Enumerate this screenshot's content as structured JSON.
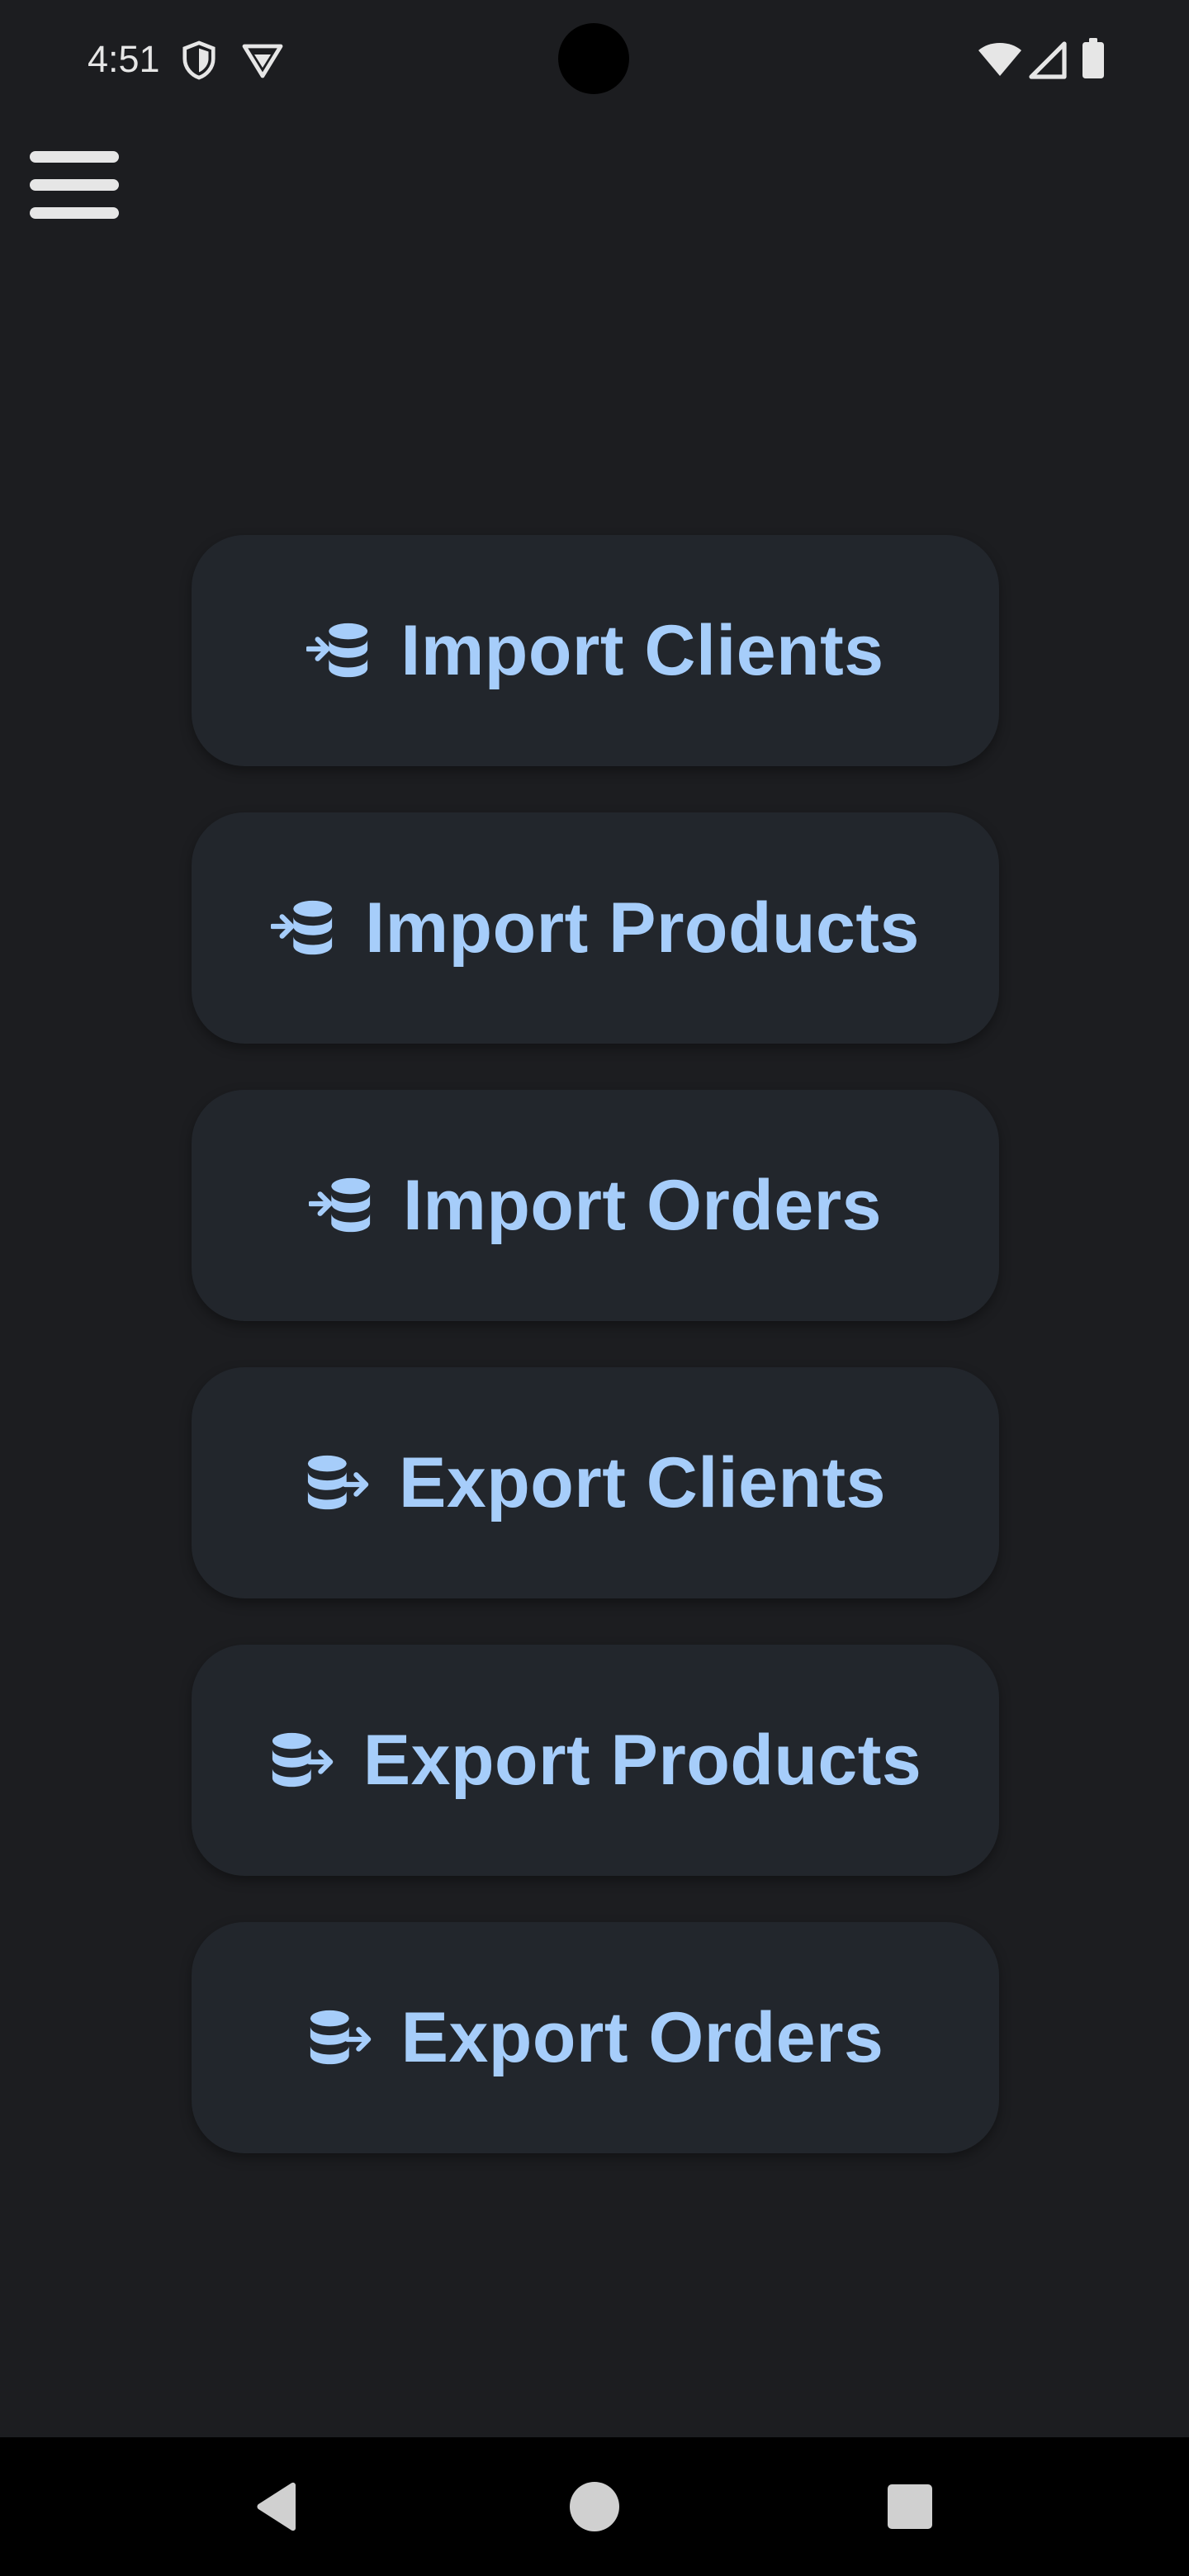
{
  "status_bar": {
    "time": "4:51",
    "icons": [
      "shield-icon",
      "vpn-icon",
      "wifi-icon",
      "cell-signal-icon",
      "battery-icon"
    ]
  },
  "toolbar": {
    "menu_icon": "hamburger-menu-icon"
  },
  "buttons": [
    {
      "label": "Import Clients",
      "icon": "database-import-icon"
    },
    {
      "label": "Import Products",
      "icon": "database-import-icon"
    },
    {
      "label": "Import Orders",
      "icon": "database-import-icon"
    },
    {
      "label": "Export Clients",
      "icon": "database-export-icon"
    },
    {
      "label": "Export Products",
      "icon": "database-export-icon"
    },
    {
      "label": "Export Orders",
      "icon": "database-export-icon"
    }
  ],
  "nav_bar": {
    "icons": [
      "back-icon",
      "home-icon",
      "recents-icon"
    ]
  },
  "colors": {
    "background": "#1c1d20",
    "button_bg": "#22262c",
    "accent": "#a6cdfa",
    "nav_bar": "#000000"
  }
}
